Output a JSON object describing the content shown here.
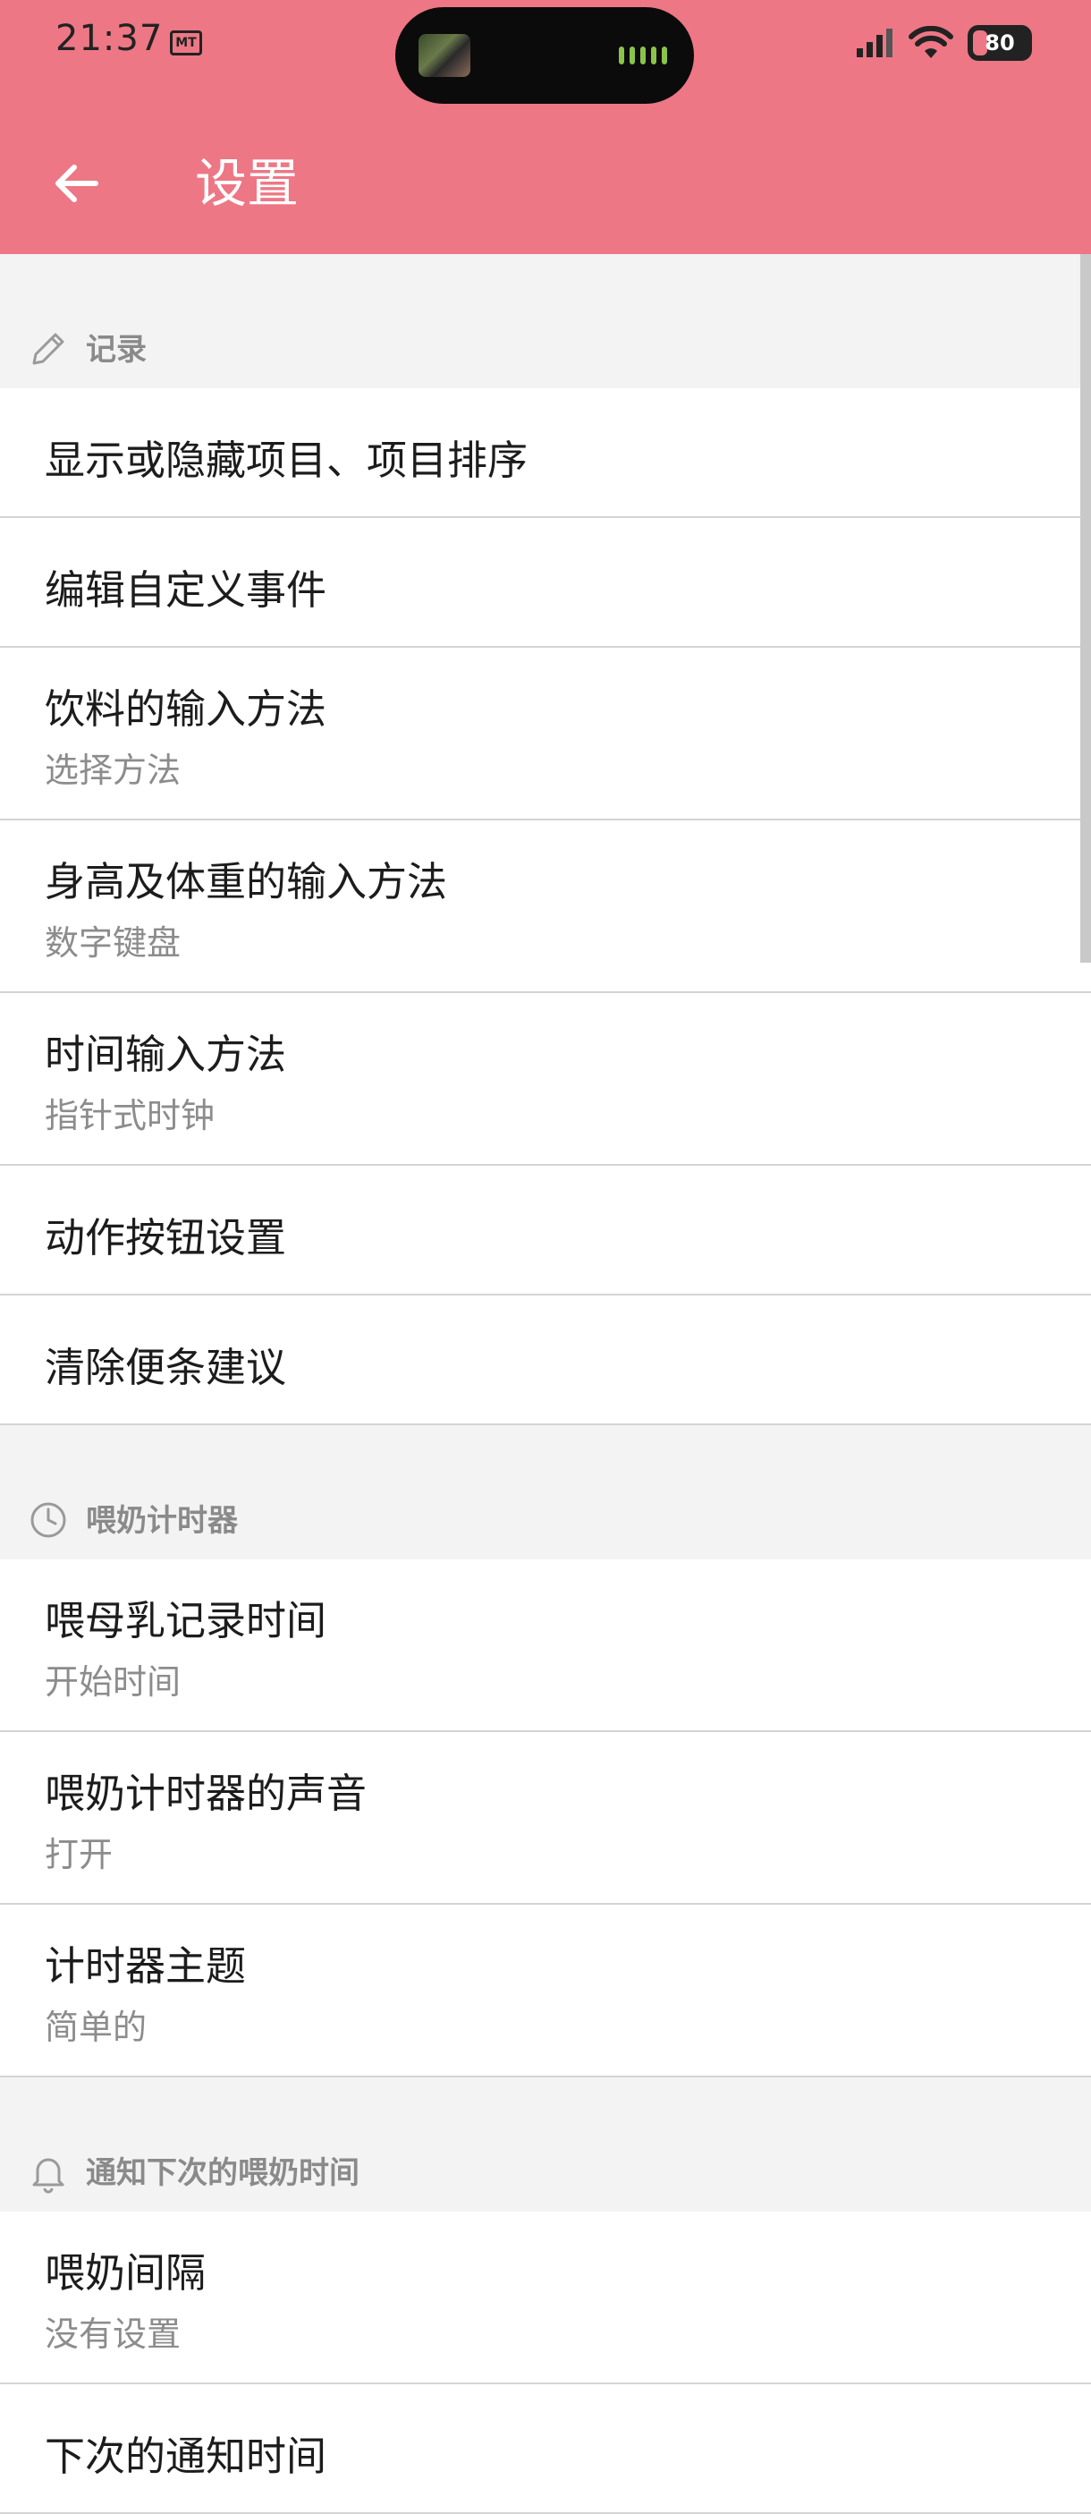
{
  "status_bar": {
    "time": "21:37",
    "badge": "MT",
    "battery": "80"
  },
  "appbar": {
    "title": "设置"
  },
  "sections": [
    {
      "label": "记录",
      "icon": "pencil-icon",
      "items": [
        {
          "title": "显示或隐藏项目、项目排序"
        },
        {
          "title": "编辑自定义事件"
        },
        {
          "title": "饮料的输入方法",
          "subtitle": "选择方法"
        },
        {
          "title": "身高及体重的输入方法",
          "subtitle": "数字键盘"
        },
        {
          "title": "时间输入方法",
          "subtitle": "指针式时钟"
        },
        {
          "title": "动作按钮设置"
        },
        {
          "title": "清除便条建议"
        }
      ]
    },
    {
      "label": "喂奶计时器",
      "icon": "clock-icon",
      "items": [
        {
          "title": "喂母乳记录时间",
          "subtitle": "开始时间"
        },
        {
          "title": "喂奶计时器的声音",
          "subtitle": "打开"
        },
        {
          "title": "计时器主题",
          "subtitle": "简单的"
        }
      ]
    },
    {
      "label": "通知下次的喂奶时间",
      "icon": "bell-icon",
      "items": [
        {
          "title": "喂奶间隔",
          "subtitle": "没有设置"
        },
        {
          "title": "下次的通知时间"
        }
      ]
    }
  ],
  "colors": {
    "header": "#ed7785",
    "background": "#f3f3f3",
    "divider": "#d4d4d4"
  }
}
